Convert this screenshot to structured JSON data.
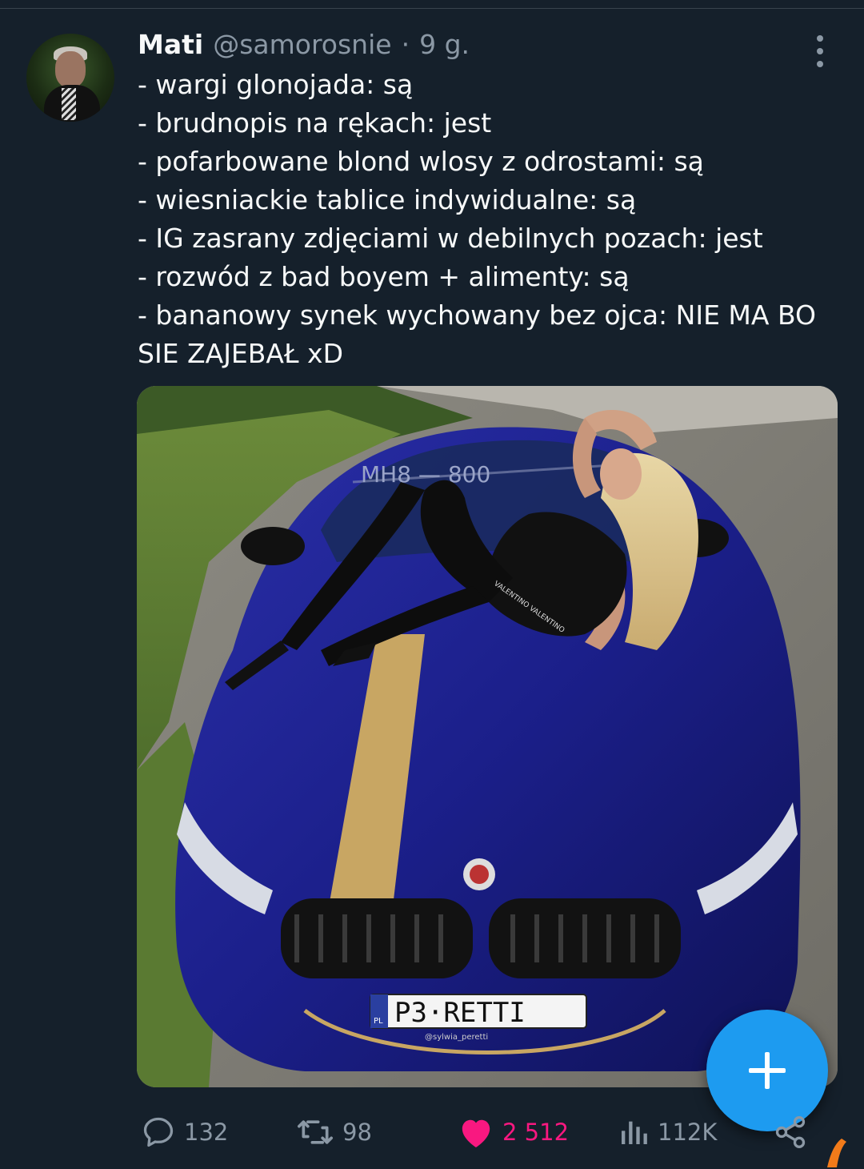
{
  "tweet": {
    "display_name": "Mati",
    "handle": "@samorosnie",
    "separator": "·",
    "time": "9 g.",
    "lines": [
      "- wargi glonojada: są",
      "- brudnopis na rękach: jest",
      "- pofarbowane blond wlosy z odrostami: są",
      "- wiesniackie tablice indywidualne: są",
      "- IG zasrany zdjęciami w debilnych pozach: jest",
      "- rozwód z bad boyem + alimenty: są",
      "- bananowy synek wychowany bez ojca: NIE MA BO",
      "SIE ZAJEBAŁ xD"
    ]
  },
  "media": {
    "windshield_text": "MH8 — 800",
    "plate_country": "PL",
    "plate_text": "P3·RETTI",
    "plate_sub": "@sylwia_peretti",
    "belt_text": "VALENTINO VALENTINO"
  },
  "actions": {
    "reply_count": "132",
    "retweet_count": "98",
    "like_count": "2 512",
    "views_count": "112K"
  },
  "icons": {
    "reply": "reply-icon",
    "retweet": "retweet-icon",
    "like": "heart-icon",
    "views": "views-icon",
    "share": "share-icon",
    "compose": "plus-icon",
    "more": "more-vertical-icon"
  },
  "colors": {
    "background": "#15202b",
    "text": "#f7f9f9",
    "muted": "#8b98a5",
    "accent": "#1d9bf0",
    "like": "#f91880"
  }
}
